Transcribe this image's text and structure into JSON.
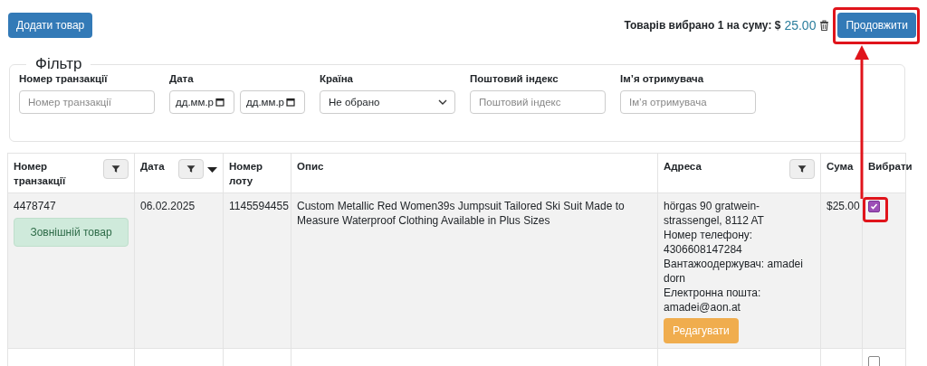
{
  "toolbar": {
    "add_button": "Додати товар",
    "summary_label": "Товарів вибрано 1 на суму: $",
    "summary_amount": "25.00",
    "continue_button": "Продовжити"
  },
  "annotations": [
    {
      "kind": "frame-continue"
    },
    {
      "kind": "frame-checkbox"
    },
    {
      "kind": "arrow"
    }
  ],
  "filter": {
    "legend": "Фільтр",
    "fields": [
      {
        "kind": "text",
        "label": "Номер транзакції",
        "placeholder": "Номер транзакції"
      },
      {
        "kind": "date-range",
        "label": "Дата",
        "from": "дд.мм.р",
        "to": "дд.мм.р"
      },
      {
        "kind": "select",
        "label": "Країна",
        "value": "Не обрано"
      },
      {
        "kind": "text",
        "label": "Поштовий індекс",
        "placeholder": "Поштовий індекс"
      },
      {
        "kind": "text",
        "label": "Ім’я отримувача",
        "placeholder": "Ім’я отримувача"
      }
    ]
  },
  "table": {
    "columns": [
      {
        "label": "Номер транзакції",
        "kind": "filter"
      },
      {
        "label": "Дата",
        "kind": "filter-sort"
      },
      {
        "label": "Номер лоту",
        "kind": "plain"
      },
      {
        "label": "Опис",
        "kind": "plain"
      },
      {
        "label": "Адреса",
        "kind": "filter"
      },
      {
        "label": "Сума",
        "kind": "plain"
      },
      {
        "label": "Вибрати",
        "kind": "plain"
      }
    ],
    "rows": [
      {
        "transaction": "4478747",
        "badge": "Зовнішній товар",
        "date": "06.02.2025",
        "lot": "1145594455",
        "description": "Custom Metallic Red Women39s Jumpsuit Tailored Ski Suit Made to Measure Waterproof Clothing Available in Plus Sizes",
        "address": [
          "hörgas 90 gratwein- strassengel, 8112 AT",
          "Номер телефону: 4306608147284",
          "Вантажоодержувач: amadei dorn",
          "Електронна пошта: amadei@aon.at"
        ],
        "edit_button": "Редагувати",
        "amount": "$25.00",
        "checked": true
      },
      {
        "checked": false
      }
    ]
  }
}
